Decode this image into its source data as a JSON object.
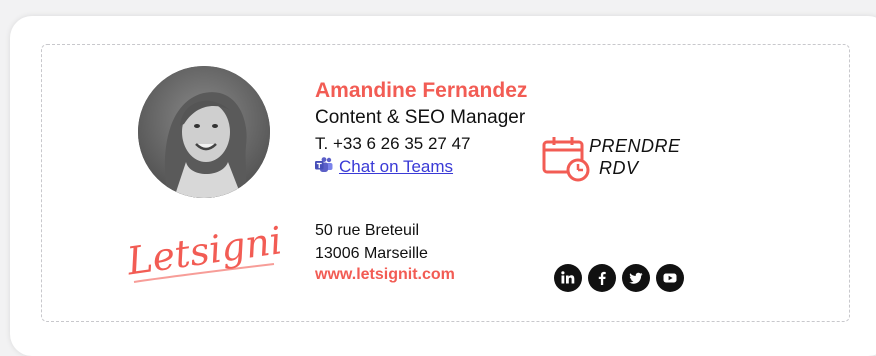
{
  "signature": {
    "name": "Amandine Fernandez",
    "role": "Content & SEO Manager",
    "phone": "T. +33 6 26 35 27 47",
    "teams_link": "Chat on Teams",
    "rdv_line1": "PRENDRE",
    "rdv_line2": "RDV",
    "address_line1": "50 rue Breteuil",
    "address_line2": "13006 Marseille",
    "website": "www.letsignit.com",
    "logo_text": "Letsignit",
    "socials": [
      "linkedin-icon",
      "facebook-icon",
      "twitter-icon",
      "youtube-icon"
    ]
  },
  "colors": {
    "accent": "#f25c54",
    "link": "#3a3ad6",
    "text": "#111111"
  }
}
